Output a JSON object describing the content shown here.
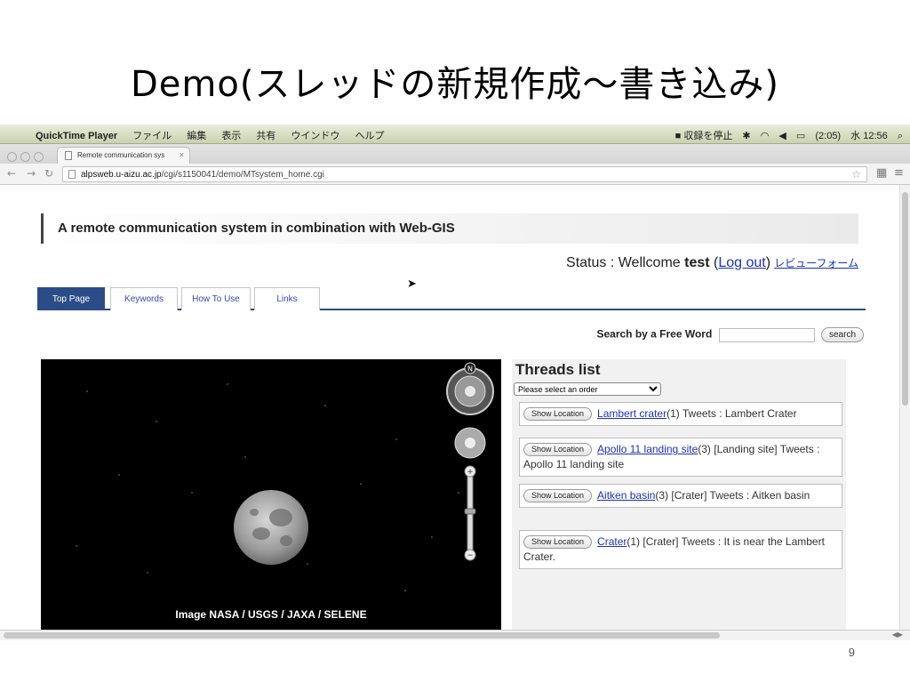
{
  "slide": {
    "title": "Demo(スレッドの新規作成～書き込み)",
    "page_number": "9"
  },
  "menubar": {
    "apple": "",
    "app_name": "QuickTime Player",
    "menus": [
      "ファイル",
      "編集",
      "表示",
      "共有",
      "ウインドウ",
      "ヘルプ"
    ],
    "status_items": [
      "■ 収録を停止",
      "(2:05)",
      "水 12:56"
    ]
  },
  "browser": {
    "tab_title": "Remote communication sys",
    "tab_close": "×",
    "url_host": "alpsweb.u-aizu.ac.jp",
    "url_path": "/cgi/s1150041/demo/MTsystem_home.cgi"
  },
  "page": {
    "banner_title": "A remote communication system in combination with Web-GIS",
    "status_prefix": "Status : Wellcome ",
    "status_user": "test",
    "status_open": " (",
    "logout_label": "Log out",
    "status_close": ")",
    "review_form_label": "レビューフォーム",
    "tabs": [
      "Top Page",
      "Keywords",
      "How To Use",
      "Links"
    ],
    "search_label": "Search by a Free Word",
    "search_value": "",
    "search_button": "search",
    "map_credit": "Image NASA / USGS / JAXA / SELENE",
    "compass_label": "N",
    "zoom_in": "+",
    "zoom_out": "−",
    "threads_title": "Threads list",
    "order_select": "Please select an order",
    "show_location_label": "Show Location",
    "threads": [
      {
        "link": "Lambert crater",
        "meta": "(1) Tweets : Lambert Crater"
      },
      {
        "link": "Apollo 11 landing site",
        "meta": "(3) [Landing site] Tweets : Apollo 11 landing site"
      },
      {
        "link": "Aitken basin",
        "meta": "(3) [Crater] Tweets : Aitken basin"
      },
      {
        "link": "Crater",
        "meta": "(1) [Crater] Tweets : It is near the Lambert Crater."
      }
    ]
  },
  "colors": {
    "tab_active": "#2c4c88",
    "link": "#1a33b8",
    "menubar": "#d6dcc0",
    "map_bg": "#000000"
  }
}
